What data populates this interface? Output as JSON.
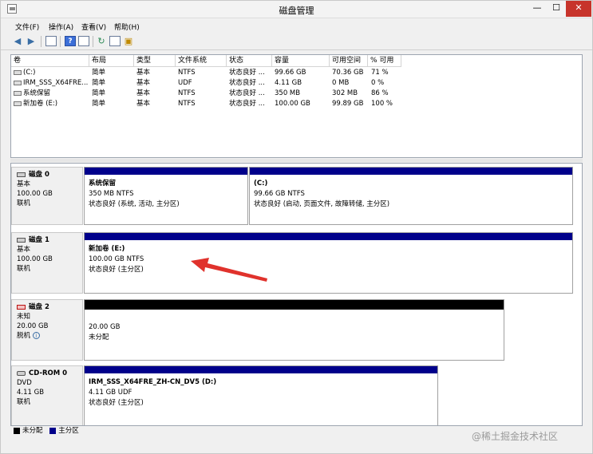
{
  "window": {
    "title": "磁盘管理",
    "min_glyph": "—",
    "max_glyph": "☐",
    "close_glyph": "✕"
  },
  "menu": [
    "文件(F)",
    "操作(A)",
    "查看(V)",
    "帮助(H)"
  ],
  "toolbar": {
    "icons": [
      "back-arrow-icon",
      "forward-arrow-icon",
      "show-hide-tree-icon",
      "help-icon",
      "properties-icon",
      "refresh-icon",
      "settings-icon",
      "rescan-icon"
    ]
  },
  "volume_table": {
    "columns": [
      "卷",
      "布局",
      "类型",
      "文件系统",
      "状态",
      "容量",
      "可用空间",
      "% 可用"
    ],
    "rows": [
      [
        "(C:)",
        "简单",
        "基本",
        "NTFS",
        "状态良好 ...",
        "99.66 GB",
        "70.36 GB",
        "71 %"
      ],
      [
        "IRM_SSS_X64FRE...",
        "简单",
        "基本",
        "UDF",
        "状态良好 ...",
        "4.11 GB",
        "0 MB",
        "0 %"
      ],
      [
        "系统保留",
        "简单",
        "基本",
        "NTFS",
        "状态良好 ...",
        "350 MB",
        "302 MB",
        "86 %"
      ],
      [
        "新加卷 (E:)",
        "简单",
        "基本",
        "NTFS",
        "状态良好 ...",
        "100.00 GB",
        "99.89 GB",
        "100 %"
      ]
    ]
  },
  "disks": [
    {
      "name": "磁盘 0",
      "type": "基本",
      "size": "100.00 GB",
      "status": "联机",
      "partitions": [
        {
          "name": "系统保留",
          "size": "350 MB NTFS",
          "status": "状态良好 (系统, 活动, 主分区)"
        },
        {
          "name": "(C:)",
          "size": "99.66 GB NTFS",
          "status": "状态良好 (启动, 页面文件, 故障转储, 主分区)"
        }
      ]
    },
    {
      "name": "磁盘 1",
      "type": "基本",
      "size": "100.00 GB",
      "status": "联机",
      "partitions": [
        {
          "name": "新加卷  (E:)",
          "size": "100.00 GB NTFS",
          "status": "状态良好 (主分区)"
        }
      ]
    },
    {
      "name": "磁盘 2",
      "type": "未知",
      "size": "20.00 GB",
      "status": "脱机",
      "partitions": [
        {
          "name": "",
          "size": "20.00 GB",
          "status": "未分配"
        }
      ]
    },
    {
      "name": "CD-ROM 0",
      "type": "DVD",
      "size": "4.11 GB",
      "status": "联机",
      "partitions": [
        {
          "name": "IRM_SSS_X64FRE_ZH-CN_DV5  (D:)",
          "size": "4.11 GB UDF",
          "status": "状态良好 (主分区)"
        }
      ]
    }
  ],
  "legend": [
    "未分配",
    "主分区"
  ],
  "watermark": "@稀土掘金技术社区",
  "colors": {
    "primary_partition": "#00008b",
    "unallocated": "#000000",
    "annotation_arrow": "#e0322c",
    "close_button": "#c7342b"
  }
}
